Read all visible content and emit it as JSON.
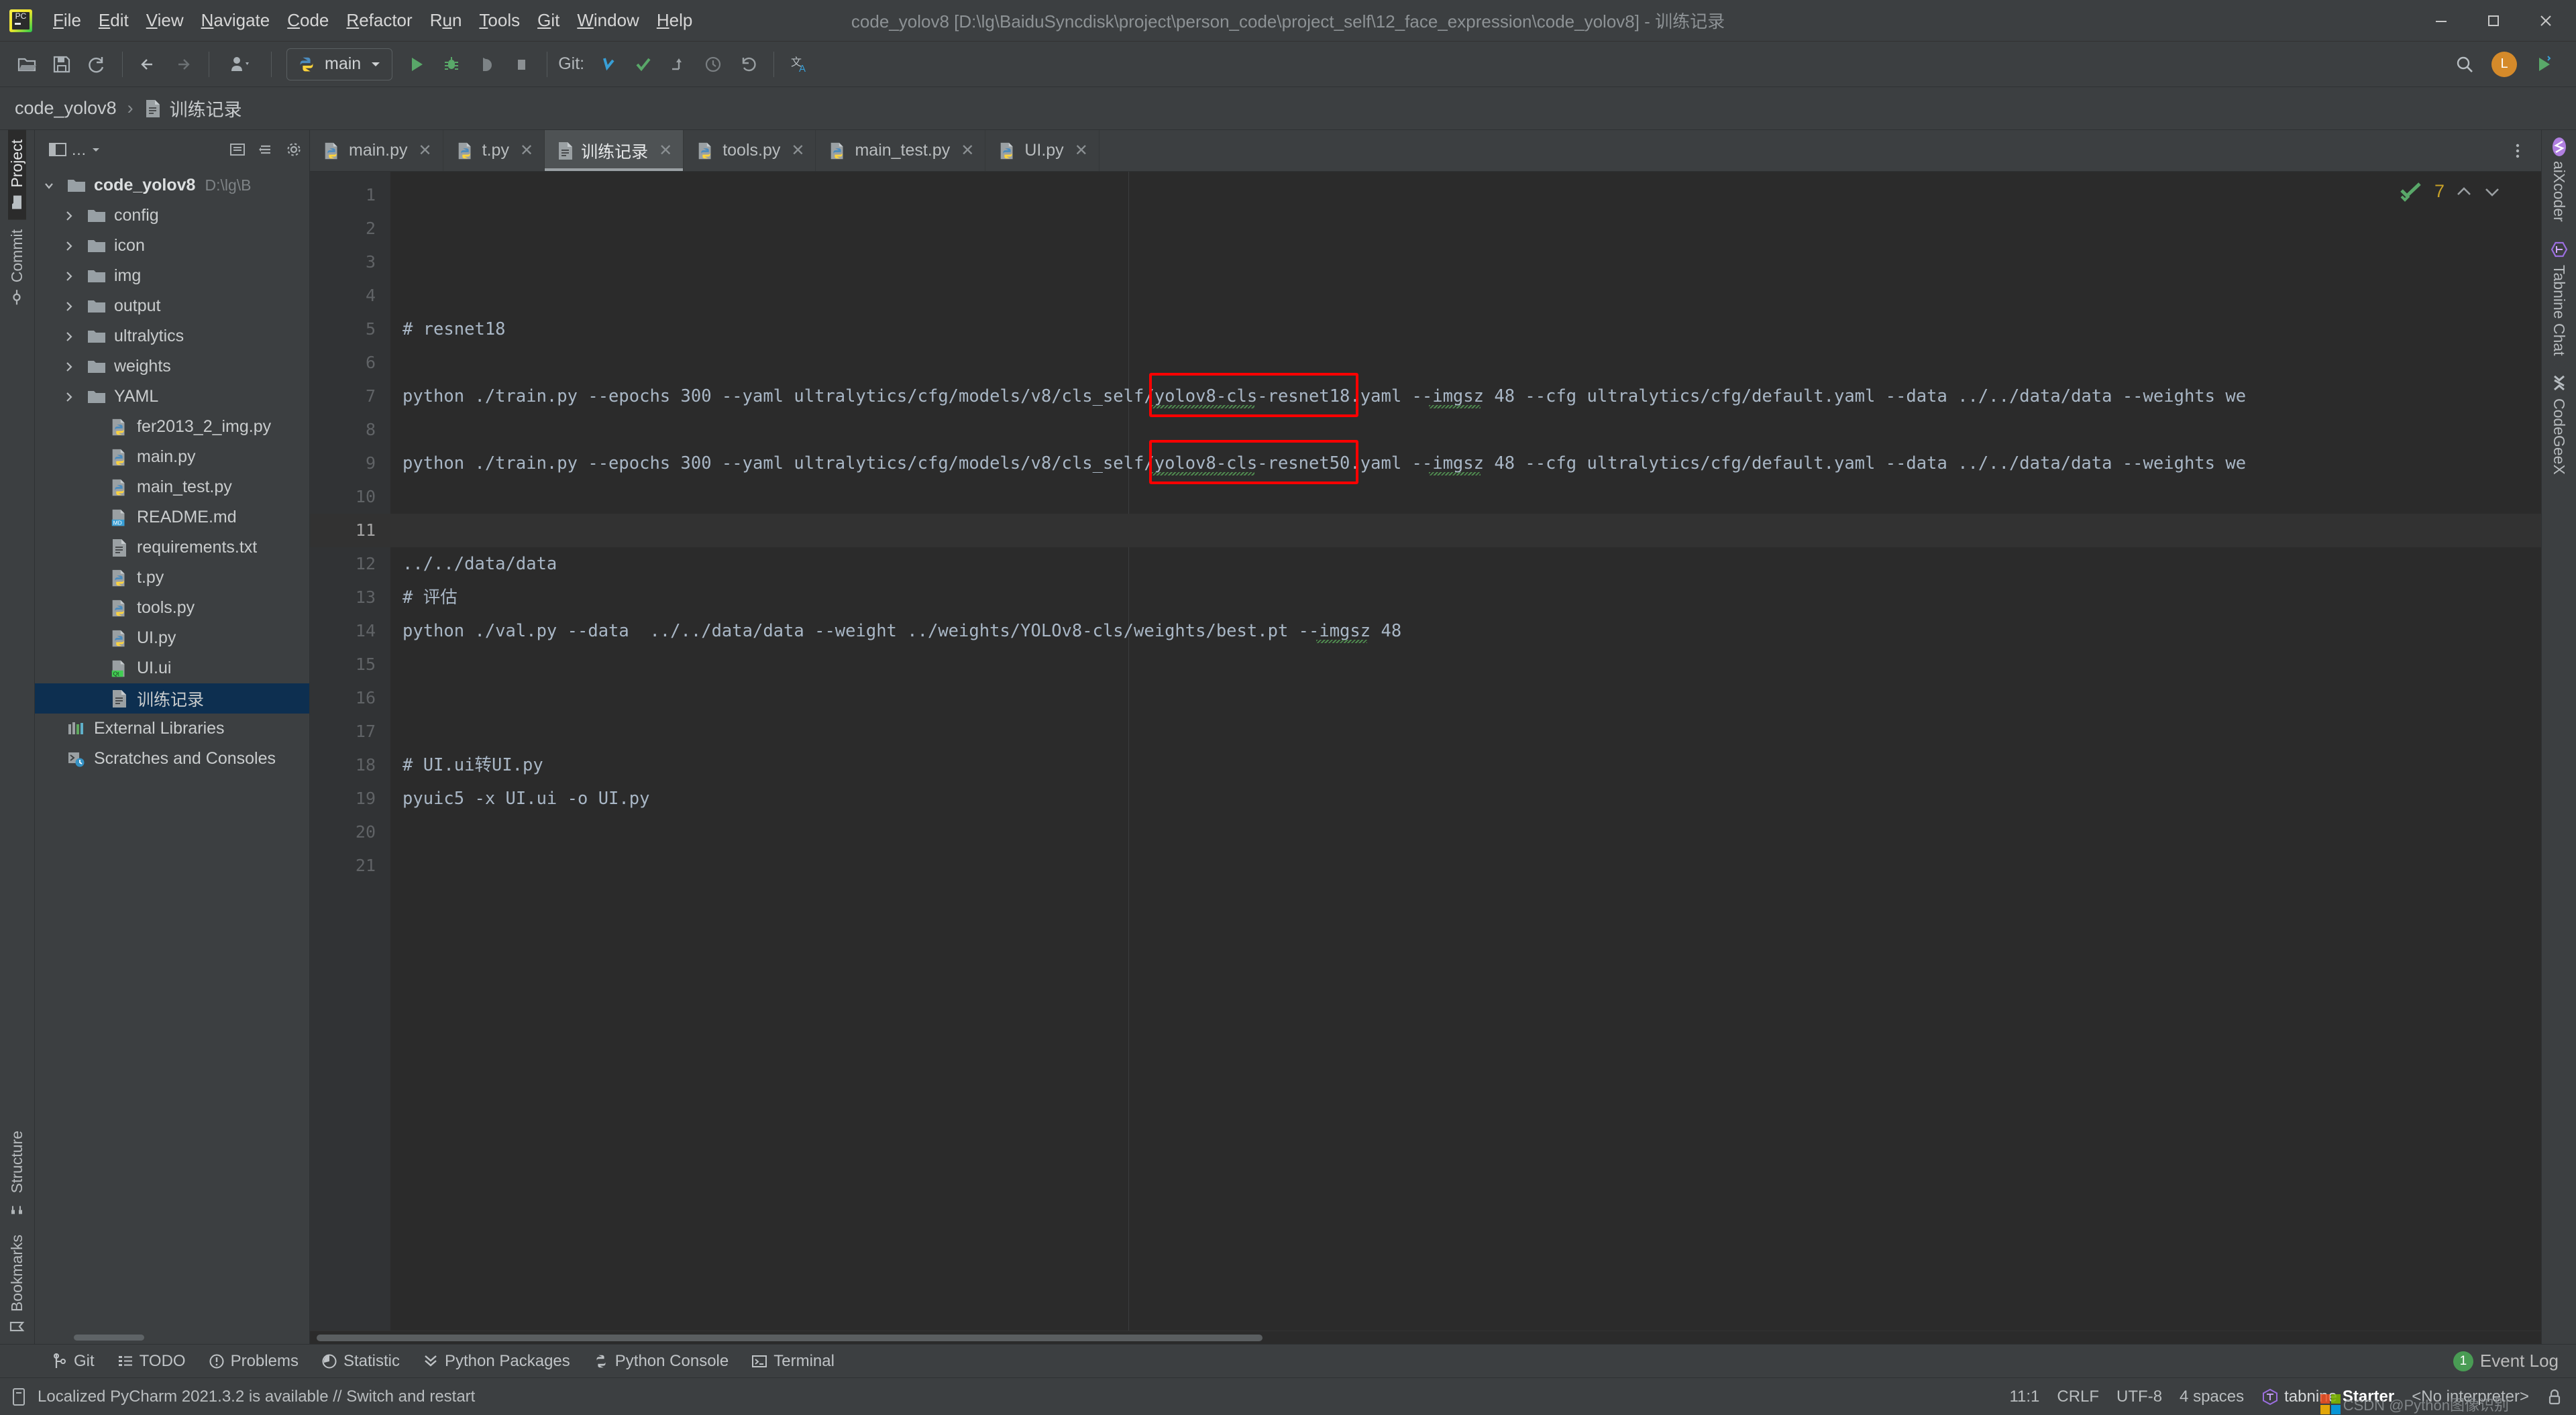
{
  "window": {
    "title": "code_yolov8 [D:\\lg\\BaiduSyncdisk\\project\\person_code\\project_self\\12_face_expression\\code_yolov8] - 训练记录",
    "minimize": "–",
    "maximize": "□",
    "close": "✕"
  },
  "menu": [
    {
      "label": "File"
    },
    {
      "label": "Edit"
    },
    {
      "label": "View"
    },
    {
      "label": "Navigate"
    },
    {
      "label": "Code"
    },
    {
      "label": "Refactor"
    },
    {
      "label": "Run"
    },
    {
      "label": "Tools"
    },
    {
      "label": "Git"
    },
    {
      "label": "Window"
    },
    {
      "label": "Help"
    }
  ],
  "toolbar": {
    "open_icon": "open-folder-icon",
    "save_icon": "save-icon",
    "sync_icon": "sync-icon",
    "back_icon": "back-arrow-icon",
    "forward_icon": "forward-arrow-icon",
    "profile_icon": "user-profile-icon",
    "run_config_name": "main",
    "run_icon": "run-icon",
    "debug_icon": "debug-icon",
    "coverage_icon": "run-with-coverage-icon",
    "stop_icon": "stop-icon",
    "git_label": "Git:",
    "update_icon": "git-update-icon",
    "commit_icon": "git-commit-icon",
    "push_icon": "git-push-icon",
    "history_icon": "git-history-icon",
    "rollback_icon": "git-rollback-icon",
    "translate_icon": "translate-icon",
    "search_icon": "search-everywhere-icon",
    "avatar_label": "L",
    "ide_run_icon": "ide-run-icon"
  },
  "breadcrumb": {
    "project": "code_yolov8",
    "separator": "›",
    "file": "训练记录",
    "file_icon": "text-file-icon"
  },
  "left_strip": {
    "project_tab": "Project",
    "commit_tab": "Commit",
    "structure_tab": "Structure",
    "bookmarks_tab": "Bookmarks"
  },
  "right_strip": {
    "aixcoder": "aiXcoder",
    "tabnine_chat": "Tabnine Chat",
    "codegeex": "CodeGeeX"
  },
  "project_panel": {
    "header_title": "…",
    "collapse_icon": "collapse-all-icon",
    "locate_icon": "select-opened-file-icon",
    "settings_icon": "gear-icon",
    "tree": [
      {
        "label": "code_yolov8",
        "path": "D:\\lg\\B",
        "kind": "root",
        "indent": 0,
        "expanded": true,
        "bold": true
      },
      {
        "label": "config",
        "kind": "folder",
        "indent": 1,
        "expanded": false
      },
      {
        "label": "icon",
        "kind": "folder",
        "indent": 1,
        "expanded": false
      },
      {
        "label": "img",
        "kind": "folder",
        "indent": 1,
        "expanded": false
      },
      {
        "label": "output",
        "kind": "folder",
        "indent": 1,
        "expanded": false
      },
      {
        "label": "ultralytics",
        "kind": "folder",
        "indent": 1,
        "expanded": false
      },
      {
        "label": "weights",
        "kind": "folder",
        "indent": 1,
        "expanded": false
      },
      {
        "label": "YAML",
        "kind": "folder",
        "indent": 1,
        "expanded": false
      },
      {
        "label": "fer2013_2_img.py",
        "kind": "python",
        "indent": 2
      },
      {
        "label": "main.py",
        "kind": "python",
        "indent": 2
      },
      {
        "label": "main_test.py",
        "kind": "python",
        "indent": 2
      },
      {
        "label": "README.md",
        "kind": "markdown",
        "indent": 2
      },
      {
        "label": "requirements.txt",
        "kind": "text",
        "indent": 2
      },
      {
        "label": "t.py",
        "kind": "python",
        "indent": 2
      },
      {
        "label": "tools.py",
        "kind": "python",
        "indent": 2
      },
      {
        "label": "UI.py",
        "kind": "python",
        "indent": 2
      },
      {
        "label": "UI.ui",
        "kind": "qt",
        "indent": 2
      },
      {
        "label": "训练记录",
        "kind": "text",
        "indent": 2,
        "selected": true
      },
      {
        "label": "External Libraries",
        "kind": "libraries",
        "indent": 0
      },
      {
        "label": "Scratches and Consoles",
        "kind": "scratches",
        "indent": 0
      }
    ]
  },
  "editor_tabs": [
    {
      "label": "main.py",
      "icon": "python-file-icon",
      "active": false,
      "close": "✕"
    },
    {
      "label": "t.py",
      "icon": "python-file-icon",
      "active": false,
      "close": "✕"
    },
    {
      "label": "训练记录",
      "icon": "text-file-icon",
      "active": true,
      "close": "✕"
    },
    {
      "label": "tools.py",
      "icon": "python-file-icon",
      "active": false,
      "close": "✕"
    },
    {
      "label": "main_test.py",
      "icon": "python-file-icon",
      "active": false,
      "close": "✕"
    },
    {
      "label": "UI.py",
      "icon": "python-file-icon",
      "active": false,
      "close": "✕"
    }
  ],
  "editor": {
    "inspection_count": "7",
    "inspection_icon": "inspection-ok-icon",
    "prev_icon": "chevron-up-icon",
    "next_icon": "chevron-down-icon",
    "caret_line": 11,
    "line_numbers": [
      1,
      2,
      3,
      4,
      5,
      6,
      7,
      8,
      9,
      10,
      11,
      12,
      13,
      14,
      15,
      16,
      17,
      18,
      19,
      20,
      21
    ],
    "lines": [
      {
        "n": 1,
        "text": ""
      },
      {
        "n": 2,
        "text": ""
      },
      {
        "n": 3,
        "text": ""
      },
      {
        "n": 4,
        "text": ""
      },
      {
        "n": 5,
        "text": "# resnet18"
      },
      {
        "n": 6,
        "text": ""
      },
      {
        "n": 7,
        "text": "python ./train.py --epochs 300 --yaml ultralytics/cfg/models/v8/cls_self/yolov8-cls-resnet18.yaml --imgsz 48 --cfg ultralytics/cfg/default.yaml --data ../../data/data --weights we"
      },
      {
        "n": 8,
        "text": ""
      },
      {
        "n": 9,
        "text": "python ./train.py --epochs 300 --yaml ultralytics/cfg/models/v8/cls_self/yolov8-cls-resnet50.yaml --imgsz 48 --cfg ultralytics/cfg/default.yaml --data ../../data/data --weights we"
      },
      {
        "n": 10,
        "text": ""
      },
      {
        "n": 11,
        "text": ""
      },
      {
        "n": 12,
        "text": "../../data/data"
      },
      {
        "n": 13,
        "text": "# 评估"
      },
      {
        "n": 14,
        "text": "python ./val.py --data  ../../data/data --weight ../weights/YOLOv8-cls/weights/best.pt --imgsz 48"
      },
      {
        "n": 15,
        "text": ""
      },
      {
        "n": 16,
        "text": ""
      },
      {
        "n": 17,
        "text": ""
      },
      {
        "n": 18,
        "text": "# UI.ui转UI.py"
      },
      {
        "n": 19,
        "text": "pyuic5 -x UI.ui -o UI.py"
      },
      {
        "n": 20,
        "text": ""
      },
      {
        "n": 21,
        "text": ""
      }
    ],
    "highlight_boxes": [
      {
        "line": 7,
        "text": "yolov8-cls-resnet18.",
        "color": "#ff0000"
      },
      {
        "line": 9,
        "text": "yolov8-cls-resnet50.",
        "color": "#ff0000"
      }
    ]
  },
  "tool_windows": [
    {
      "label": "Git",
      "icon": "git-branch-icon"
    },
    {
      "label": "TODO",
      "icon": "todo-list-icon"
    },
    {
      "label": "Problems",
      "icon": "problems-icon"
    },
    {
      "label": "Statistic",
      "icon": "statistic-icon"
    },
    {
      "label": "Python Packages",
      "icon": "python-packages-icon"
    },
    {
      "label": "Python Console",
      "icon": "python-console-icon"
    },
    {
      "label": "Terminal",
      "icon": "terminal-icon"
    }
  ],
  "event_log": {
    "label": "Event Log",
    "badge": "1"
  },
  "status_bar": {
    "message": "Localized PyCharm 2021.3.2 is available // Switch and restart",
    "message_icon": "notification-icon",
    "caret_position": "11:1",
    "line_separator": "CRLF",
    "encoding": "UTF-8",
    "indent": "4 spaces",
    "tabnine_name": "tabnine",
    "tabnine_plan": "Starter",
    "interpreter": "<No interpreter>",
    "lock_icon": "lock-icon",
    "watermark": "CSDN @Python图像识别"
  },
  "colors": {
    "background": "#3c3f41",
    "editor_background": "#2b2b2b",
    "gutter": "#313335",
    "selection": "#0d2f50",
    "code_text": "#a9b7c6",
    "accent_red": "#ff0000",
    "accent_green": "#499c54",
    "accent_yellow": "#c9a227"
  }
}
